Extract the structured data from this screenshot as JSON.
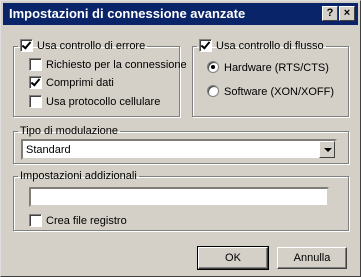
{
  "window": {
    "title": "Impostazioni di connessione avanzate",
    "help_label": "?",
    "close_label": "×"
  },
  "error_control": {
    "label": "Usa controllo di errore",
    "checked": true,
    "options": [
      {
        "label": "Richiesto per la connessione",
        "checked": false
      },
      {
        "label": "Comprimi dati",
        "checked": true
      },
      {
        "label": "Usa protocollo cellulare",
        "checked": false
      }
    ]
  },
  "flow_control": {
    "label": "Usa controllo di flusso",
    "checked": true,
    "options": [
      {
        "label": "Hardware (RTS/CTS)",
        "selected": true
      },
      {
        "label": "Software (XON/XOFF)",
        "selected": false
      }
    ]
  },
  "modulation": {
    "label": "Tipo di modulazione",
    "value": "Standard"
  },
  "extra": {
    "label": "Impostazioni addizionali",
    "value": "",
    "log_label": "Crea file registro",
    "log_checked": false
  },
  "buttons": {
    "ok": "OK",
    "cancel": "Annulla"
  }
}
